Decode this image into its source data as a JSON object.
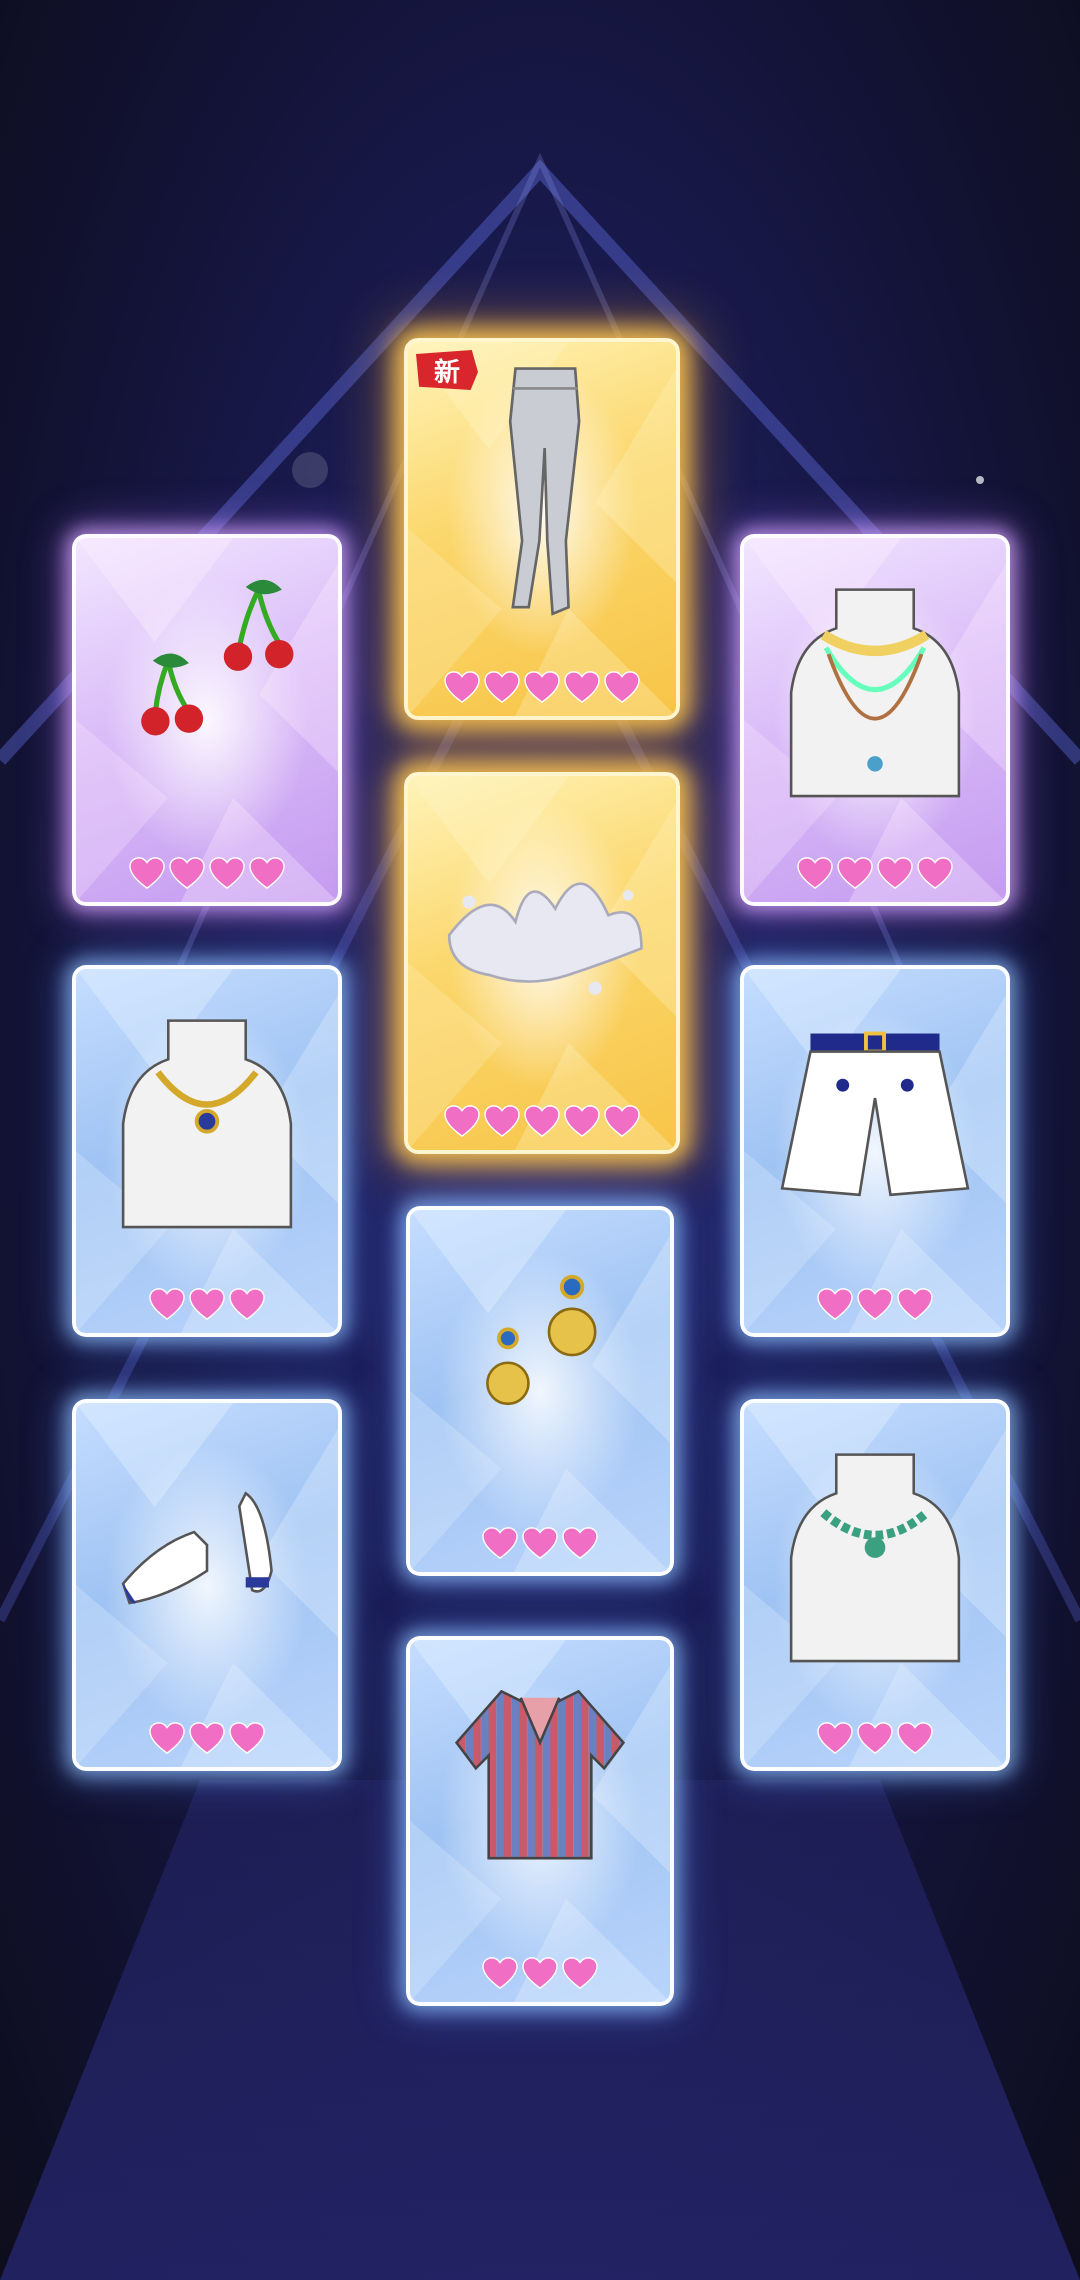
{
  "screen": "gacha-results",
  "colors": {
    "background": "#1b1c55",
    "heart": "#f06fc4",
    "rarity3_border": "#bcd8ff",
    "rarity4_border": "#e3c4ff",
    "rarity5_border": "#ffd36a"
  },
  "cards": [
    {
      "id": "pantyhose",
      "rarity": 5,
      "hearts": 5,
      "is_new": true,
      "badge": "新",
      "icon": "pantyhose-icon"
    },
    {
      "id": "cherry-earrings",
      "rarity": 4,
      "hearts": 4,
      "is_new": false,
      "icon": "cherry-icon"
    },
    {
      "id": "flower-layered-necklace",
      "rarity": 4,
      "hearts": 4,
      "is_new": false,
      "icon": "layered-necklace-icon"
    },
    {
      "id": "splash-effect",
      "rarity": 5,
      "hearts": 5,
      "is_new": false,
      "icon": "water-splash-icon"
    },
    {
      "id": "chain-pendant-necklace",
      "rarity": 3,
      "hearts": 3,
      "is_new": false,
      "icon": "pendant-necklace-icon"
    },
    {
      "id": "white-shorts",
      "rarity": 3,
      "hearts": 3,
      "is_new": false,
      "icon": "shorts-icon"
    },
    {
      "id": "gold-sun-earrings",
      "rarity": 3,
      "hearts": 3,
      "is_new": false,
      "icon": "sun-earrings-icon"
    },
    {
      "id": "white-loafers",
      "rarity": 3,
      "hearts": 3,
      "is_new": false,
      "icon": "loafers-icon"
    },
    {
      "id": "green-gem-necklace",
      "rarity": 3,
      "hearts": 3,
      "is_new": false,
      "icon": "gem-necklace-icon"
    },
    {
      "id": "striped-shirt",
      "rarity": 3,
      "hearts": 3,
      "is_new": false,
      "icon": "striped-shirt-icon"
    }
  ]
}
